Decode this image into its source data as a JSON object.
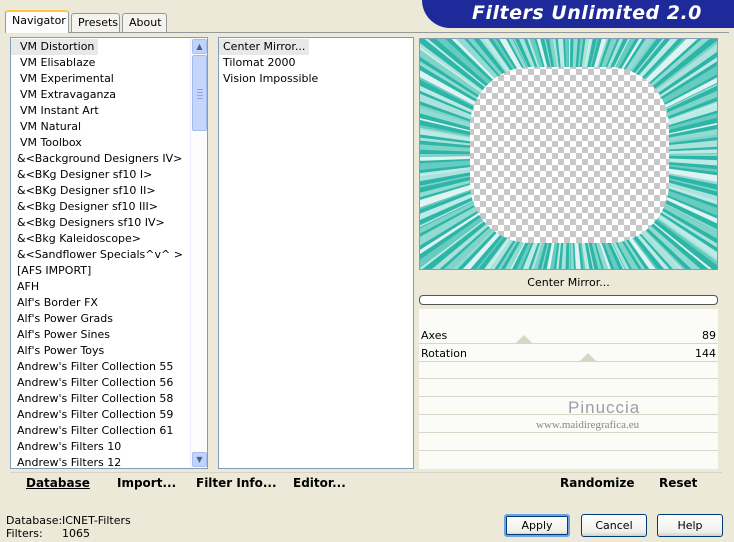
{
  "tabs": [
    {
      "label": "Navigator",
      "active": true
    },
    {
      "label": "Presets",
      "active": false
    },
    {
      "label": "About",
      "active": false
    }
  ],
  "banner": {
    "title": "Filters Unlimited 2.0"
  },
  "categories": {
    "items": [
      "VM Distortion",
      "VM Elisablaze",
      "VM Experimental",
      "VM Extravaganza",
      "VM Instant Art",
      "VM Natural",
      "VM Toolbox",
      "&<Background Designers IV>",
      "&<BKg Designer sf10 I>",
      "&<BKg Designer sf10 II>",
      "&<Bkg Designer sf10 III>",
      "&<Bkg Designers sf10 IV>",
      "&<Bkg Kaleidoscope>",
      "&<Sandflower Specials^v^ >",
      "[AFS IMPORT]",
      "AFH",
      "Alf's Border FX",
      "Alf's Power Grads",
      "Alf's Power Sines",
      "Alf's Power Toys",
      "Andrew's Filter Collection 55",
      "Andrew's Filter Collection 56",
      "Andrew's Filter Collection 58",
      "Andrew's Filter Collection 59",
      "Andrew's Filter Collection 61",
      "Andrew's Filters 10",
      "Andrew's Filters 12"
    ],
    "selected_index": 0
  },
  "filters": {
    "items": [
      "Center Mirror...",
      "Tilomat 2000",
      "Vision Impossible"
    ],
    "selected_index": 0
  },
  "preview": {
    "caption": "Center Mirror...",
    "accent": "#2db6a8"
  },
  "params": [
    {
      "name": "Axes",
      "value": "89",
      "fraction": 0.35
    },
    {
      "name": "Rotation",
      "value": "144",
      "fraction": 0.565
    }
  ],
  "watermark": {
    "line1": "Pinuccia",
    "line2": "www.maidiregrafica.eu"
  },
  "toolbar": {
    "database": "Database",
    "import": "Import...",
    "filter_info": "Filter Info...",
    "editor": "Editor...",
    "randomize": "Randomize",
    "reset": "Reset"
  },
  "status": {
    "database_label": "Database:",
    "database_value": "ICNET-Filters",
    "filters_label": "Filters:",
    "filters_value": "1065"
  },
  "buttons": {
    "apply": "Apply",
    "cancel": "Cancel",
    "help": "Help"
  }
}
